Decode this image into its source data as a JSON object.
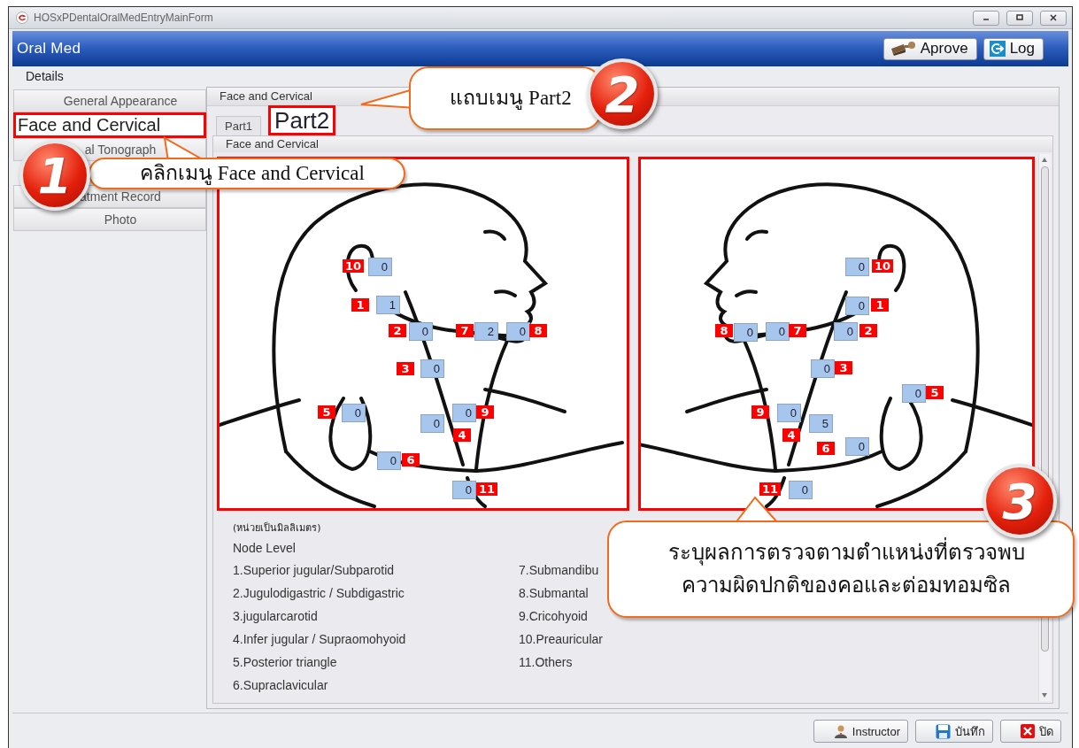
{
  "window": {
    "title": "HOSxPDentalOralMedEntryMainForm"
  },
  "header": {
    "title": "Oral Med",
    "buttons": [
      {
        "label": "Aprove",
        "kind": "approve"
      },
      {
        "label": "Log",
        "kind": "log"
      }
    ]
  },
  "tabs": [
    {
      "label": "Details",
      "selected": true
    }
  ],
  "sidebar": {
    "items": [
      {
        "label": "General Appearance",
        "selected": false
      },
      {
        "label": "Face and Cervical",
        "selected": true
      },
      {
        "label": "al Tonograph",
        "selected": false
      },
      {
        "label": "atment Record",
        "selected": false
      },
      {
        "label": "Photo",
        "selected": false
      }
    ]
  },
  "panel": {
    "title": "Face and Cervical",
    "subtabs": [
      {
        "label": "Part1",
        "selected": false
      },
      {
        "label": "Part2",
        "selected": true
      }
    ],
    "section_title": "Face and Cervical",
    "diagrams": [
      {
        "kind": "facing-right",
        "nodes": [
          {
            "number": "1",
            "value": "1"
          },
          {
            "number": "2",
            "value": "0"
          },
          {
            "number": "3",
            "value": "0"
          },
          {
            "number": "4",
            "value": "0"
          },
          {
            "number": "5",
            "value": "0"
          },
          {
            "number": "6",
            "value": "0"
          },
          {
            "number": "7",
            "value": "2"
          },
          {
            "number": "8",
            "value": "0"
          },
          {
            "number": "9",
            "value": "0"
          },
          {
            "number": "10",
            "value": "0"
          },
          {
            "number": "11",
            "value": "0"
          }
        ]
      },
      {
        "kind": "facing-left",
        "nodes": [
          {
            "number": "10",
            "value": "0"
          },
          {
            "number": "1",
            "value": "0"
          },
          {
            "number": "8",
            "value": "0"
          },
          {
            "number": "7",
            "value": "0"
          },
          {
            "number": "2",
            "value": "0"
          },
          {
            "number": "3",
            "value": "0"
          },
          {
            "number": "5",
            "value": "0"
          },
          {
            "number": "9",
            "value": "0"
          },
          {
            "number": "4",
            "value": "5"
          },
          {
            "number": "6",
            "value": "0"
          },
          {
            "number": "11",
            "value": "0"
          }
        ]
      }
    ],
    "unit_note": "(หน่วยเป็นมิลลิเมตร)",
    "legend_title": "Node Level",
    "legend": [
      "1.Superior jugular/Subparotid",
      "2.Jugulodigastric / Subdigastric",
      "3.jugularcarotid",
      "4.Infer jugular / Supraomohyoid",
      "5.Posterior triangle",
      "6.Supraclavicular",
      "7.Submandibu",
      "8.Submantal",
      "9.Cricohyoid",
      "10.Preauricular",
      "11.Others"
    ]
  },
  "footer": {
    "buttons": [
      {
        "label": "Instructor",
        "kind": "instructor"
      },
      {
        "label": "บันทึก",
        "kind": "save"
      },
      {
        "label": "ปิด",
        "kind": "close"
      }
    ]
  },
  "callouts": [
    {
      "number": "1",
      "text": "คลิกเมนู Face and Cervical"
    },
    {
      "number": "2",
      "text": "แถบเมนู Part2"
    },
    {
      "number": "3",
      "text": "ระบุผลการตรวจตามตำแหน่งที่ตรวจพบ\nความผิดปกติของคอและต่อมทอมซิล"
    }
  ]
}
